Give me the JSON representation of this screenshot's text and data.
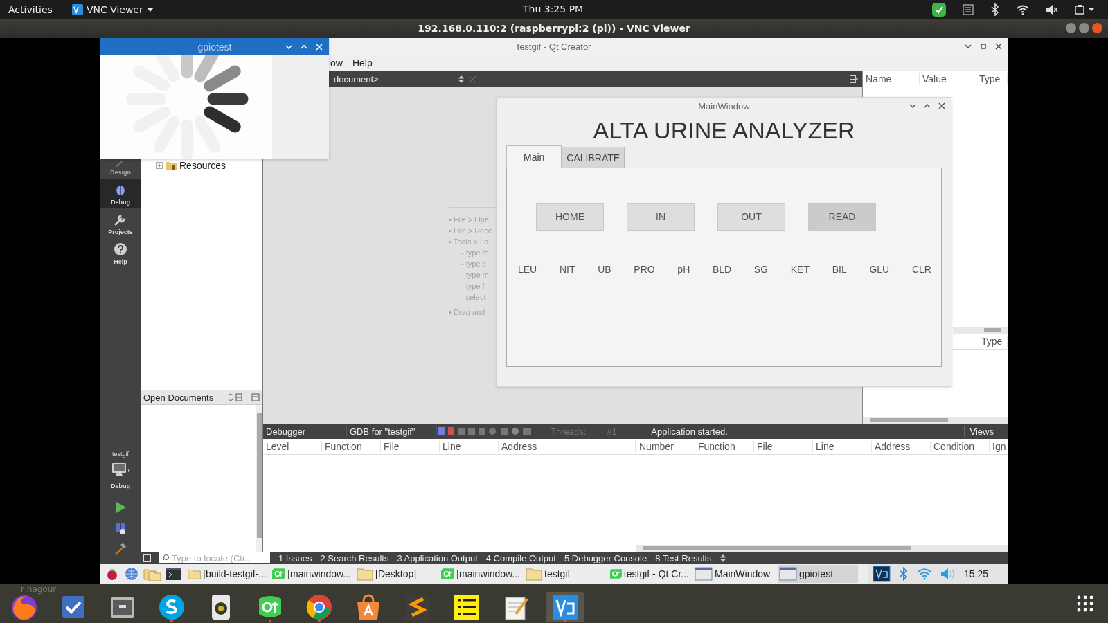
{
  "top_bar": {
    "activities": "Activities",
    "app_menu": "VNC Viewer",
    "clock": "Thu  3:25 PM"
  },
  "vnc_window": {
    "title": "192.168.0.110:2 (raspberrypi:2 (pi)) - VNC Viewer"
  },
  "qt_creator": {
    "title": "testgif - Qt Creator",
    "menu": [
      "ow",
      "Help"
    ],
    "modes": [
      {
        "label": "Design",
        "kind": "design",
        "selected": false
      },
      {
        "label": "Debug",
        "kind": "debug",
        "selected": true
      },
      {
        "label": "Projects",
        "kind": "projects",
        "selected": false
      },
      {
        "label": "Help",
        "kind": "help",
        "selected": false
      }
    ],
    "kit": {
      "project": "testgif",
      "build": "Debug"
    },
    "project_tree": [
      {
        "label": "Resources",
        "expanded": false
      }
    ],
    "open_documents": "Open Documents",
    "editor": {
      "document": "document>",
      "hints": [
        "• File > Ope",
        "• File > Rece",
        "• Tools > Lo",
        "- type to",
        "- type c",
        "- type m",
        "- type f",
        "- select",
        "• Drag and"
      ]
    },
    "locals": {
      "columns": [
        "Name",
        "Value",
        "Type"
      ],
      "lower_columns": [
        "Type"
      ]
    },
    "debugger": {
      "engine": "Debugger",
      "gdb": "GDB for \"testgif\"",
      "threads_label": "Threads:",
      "thread": "#1",
      "status": "Application started.",
      "views": "Views",
      "stack_columns": [
        "Level",
        "Function",
        "File",
        "Line",
        "Address"
      ],
      "breakpoint_columns": [
        "Number",
        "Function",
        "File",
        "Line",
        "Address",
        "Condition",
        "Ign"
      ]
    },
    "locator": {
      "placeholder": "Type to locate (Ctr..."
    },
    "output_tabs": [
      "1 Issues",
      "2 Search Results",
      "3 Application Output",
      "4 Compile Output",
      "5 Debugger Console",
      "8 Test Results"
    ]
  },
  "main_window": {
    "title": "MainWindow",
    "heading": "ALTA URINE ANALYZER",
    "tabs": [
      {
        "label": "Main",
        "selected": true
      },
      {
        "label": "CALIBRATE",
        "selected": false
      }
    ],
    "buttons": [
      {
        "label": "HOME",
        "pressed": false
      },
      {
        "label": "IN",
        "pressed": false
      },
      {
        "label": "OUT",
        "pressed": false
      },
      {
        "label": "READ",
        "pressed": true
      }
    ],
    "parameters": [
      "LEU",
      "NIT",
      "UB",
      "PRO",
      "pH",
      "BLD",
      "SG",
      "KET",
      "BIL",
      "GLU",
      "CLR"
    ]
  },
  "gpiotest": {
    "title": "gpiotest"
  },
  "remote_taskbar": {
    "windows": [
      {
        "label": "[build-testgif-...",
        "kind": "folder",
        "selected": false
      },
      {
        "label": "[mainwindow...",
        "kind": "qt",
        "selected": false
      },
      {
        "label": "[Desktop]",
        "kind": "folder",
        "selected": false
      },
      {
        "label": "[mainwindow...",
        "kind": "qt",
        "selected": false
      },
      {
        "label": "testgif",
        "kind": "folder",
        "selected": false
      },
      {
        "label": "testgif - Qt Cr...",
        "kind": "qt",
        "selected": false
      },
      {
        "label": "MainWindow",
        "kind": "window",
        "selected": false
      },
      {
        "label": "gpiotest",
        "kind": "window",
        "selected": true
      }
    ],
    "clock": "15:25"
  },
  "dock": {
    "overlay_text": "r nagour",
    "apps": [
      {
        "kind": "fox",
        "running": false,
        "selected": false
      },
      {
        "kind": "tasks",
        "running": false,
        "selected": false
      },
      {
        "kind": "cabinet",
        "running": false,
        "selected": false
      },
      {
        "kind": "chat",
        "running": true,
        "selected": false
      },
      {
        "kind": "speaker",
        "running": false,
        "selected": false
      },
      {
        "kind": "leaf",
        "running": true,
        "selected": false
      },
      {
        "kind": "wheel",
        "running": true,
        "selected": false
      },
      {
        "kind": "bag",
        "running": false,
        "selected": false
      },
      {
        "kind": "ribbon",
        "running": false,
        "selected": false
      },
      {
        "kind": "notes",
        "running": false,
        "selected": false
      },
      {
        "kind": "notepad",
        "running": false,
        "selected": false
      },
      {
        "kind": "remote",
        "running": true,
        "selected": true
      }
    ]
  }
}
